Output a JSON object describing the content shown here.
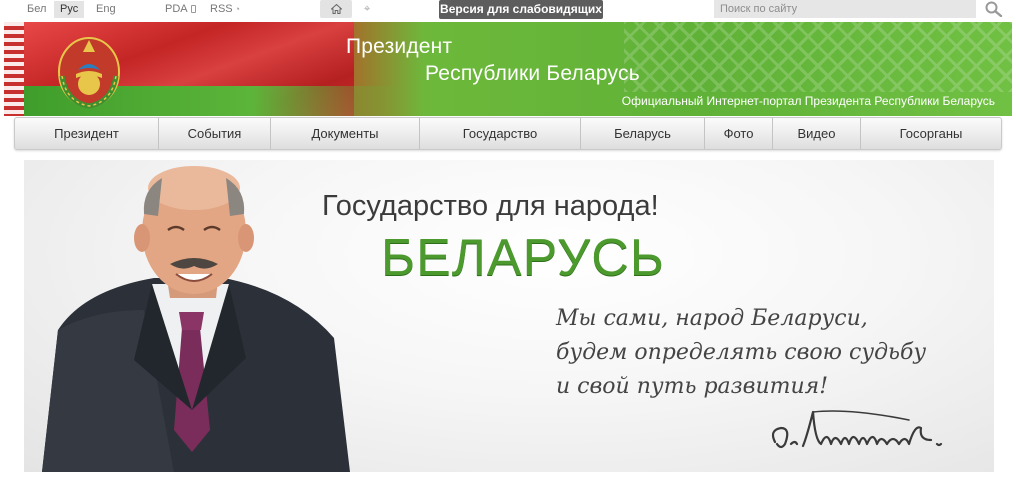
{
  "topbar": {
    "languages": [
      {
        "label": "Бел",
        "active": false
      },
      {
        "label": "Рус",
        "active": true
      },
      {
        "label": "Eng",
        "active": false
      }
    ],
    "pda_label": "PDA",
    "rss_label": "RSS",
    "home_icon": "home-icon",
    "sitemap_icon": "sitemap-icon",
    "vision_label": "Версия для слабовидящих",
    "search_placeholder": "Поиск по сайту",
    "search_icon": "magnifier-icon"
  },
  "header": {
    "title_line1": "Президент",
    "title_line2": "Республики Беларусь",
    "subtitle": "Официальный Интернет-портал Президента Республики Беларусь",
    "emblem_icon": "state-emblem-icon"
  },
  "nav": {
    "items": [
      {
        "label": "Президент"
      },
      {
        "label": "События"
      },
      {
        "label": "Документы"
      },
      {
        "label": "Государство"
      },
      {
        "label": "Беларусь"
      },
      {
        "label": "Фото"
      },
      {
        "label": "Видео"
      },
      {
        "label": "Госорганы"
      }
    ]
  },
  "hero": {
    "slogan": "Государство для народа!",
    "country": "БЕЛАРУСЬ",
    "quote": [
      "Мы сами, народ Беларуси,",
      "будем определять свою судьбу",
      "и свой путь развития!"
    ]
  },
  "colors": {
    "header_green": "#5fb237",
    "flag_red": "#d53130",
    "hero_green_text": "#4c9a2e",
    "vision_button": "#5d5d5d"
  }
}
